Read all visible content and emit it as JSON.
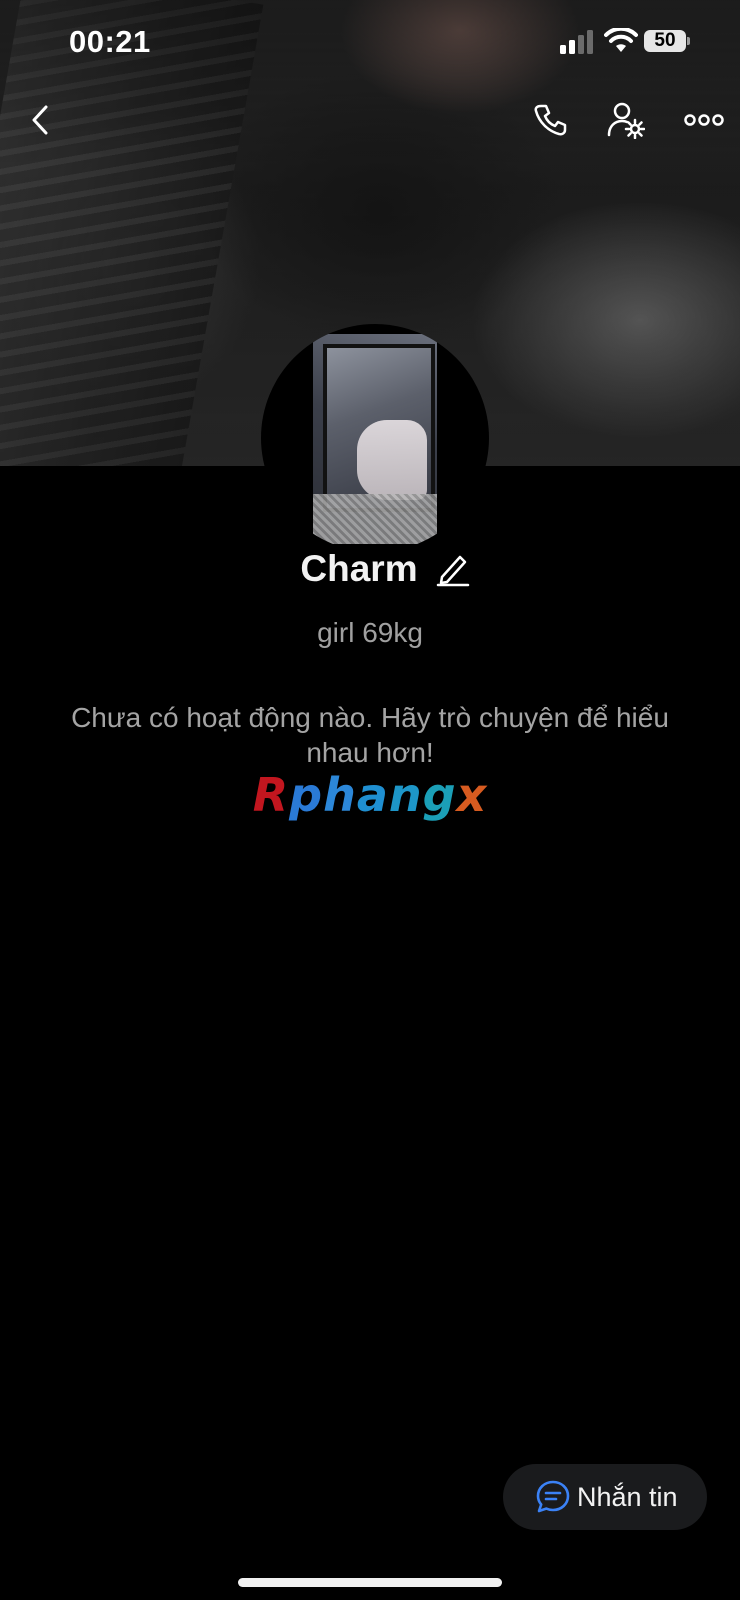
{
  "status_bar": {
    "time": "00:21",
    "battery_level": "50"
  },
  "nav": {
    "icons": [
      "chevron-left-icon",
      "phone-icon",
      "user-gear-icon",
      "more-icon"
    ]
  },
  "profile": {
    "name": "Charm",
    "bio": "girl 69kg",
    "empty_state": "Chưa có hoạt động nào. Hãy trò chuyện để hiểu nhau hơn!"
  },
  "watermark": {
    "r": "R",
    "p": "p",
    "h": "h",
    "a": "a",
    "n": "n",
    "g": "g",
    "x": "x"
  },
  "actions": {
    "message_label": "Nhắn tin"
  },
  "colors": {
    "background": "#000000",
    "button_bg": "#1a1b1d",
    "accent": "#3b82f6"
  }
}
